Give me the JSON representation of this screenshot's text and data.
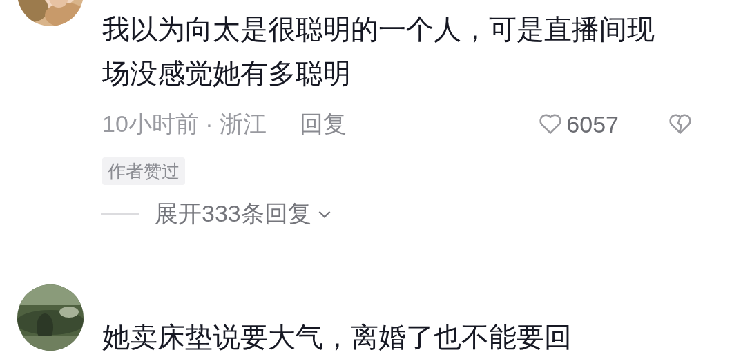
{
  "comments": [
    {
      "text": "我以为向太是很聪明的一个人，可是直播间现场没感觉她有多聪明",
      "time_location": "10小时前 · 浙江",
      "reply": "回复",
      "likes": "6057",
      "author_liked": "作者赞过",
      "expand_replies": "展开333条回复"
    },
    {
      "text": "她卖床垫说要大气，离婚了也不能要回"
    }
  ]
}
